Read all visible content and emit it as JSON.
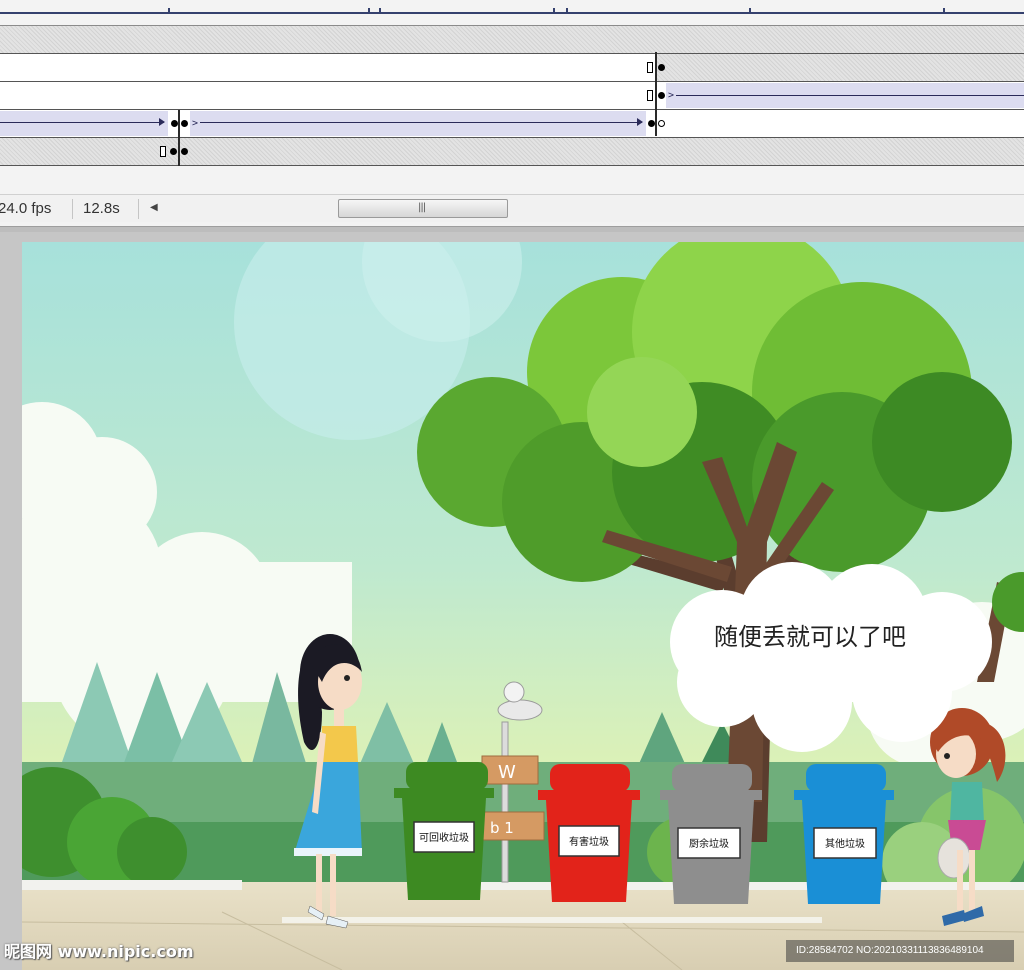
{
  "timeline": {
    "frame_rate": "24.0 fps",
    "elapsed_time": "12.8s"
  },
  "stage": {
    "speech_bubble": "随便丢就可以了吧",
    "signpost_top": "W",
    "signpost_bottom": "b 1",
    "bins": [
      {
        "label": "可回收垃圾",
        "color": "#3d8a22"
      },
      {
        "label": "有害垃圾",
        "color": "#e2231a"
      },
      {
        "label": "厨余垃圾",
        "color": "#8e8e8e"
      },
      {
        "label": "其他垃圾",
        "color": "#1a8fd6"
      }
    ]
  },
  "watermark": {
    "brand": "昵图网 www.nipic.com",
    "id_text": "ID:28584702 NO:20210331113836489104"
  }
}
